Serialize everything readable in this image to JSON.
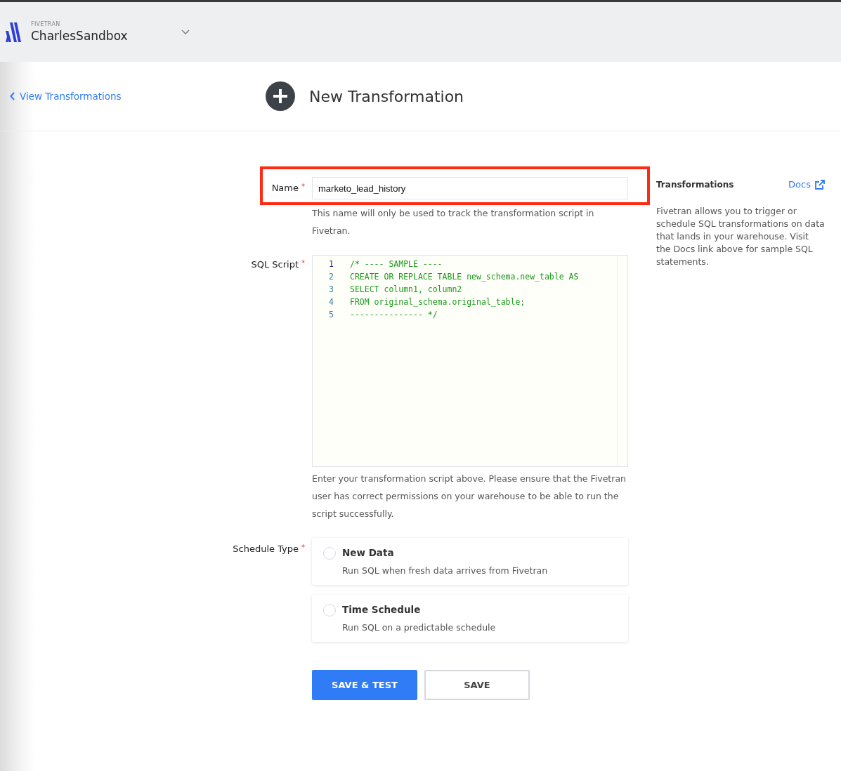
{
  "account": {
    "brand": "FIVETRAN",
    "name": "CharlesSandbox"
  },
  "header": {
    "back_link": "View Transformations",
    "title": "New Transformation"
  },
  "form": {
    "name_field": {
      "label": "Name",
      "required_mark": "*",
      "value": "marketo_lead_history",
      "highlighted": true,
      "help": "This name will only be used to track the transformation script in Fivetran."
    },
    "sql_field": {
      "label": "SQL Script",
      "required_mark": "*",
      "lines": [
        {
          "number": "1",
          "code": "/* ---- SAMPLE ----"
        },
        {
          "number": "2",
          "code": "CREATE OR REPLACE TABLE new_schema.new_table AS"
        },
        {
          "number": "3",
          "code": "SELECT column1, column2"
        },
        {
          "number": "4",
          "code": "FROM original_schema.original_table;"
        },
        {
          "number": "5",
          "code": "--------------- */"
        }
      ],
      "help": "Enter your transformation script above. Please ensure that the Fivetran user has correct permissions on your warehouse to be able to run the script successfully."
    },
    "schedule": {
      "label": "Schedule Type",
      "required_mark": "*",
      "options": [
        {
          "title": "New Data",
          "description": "Run SQL when fresh data arrives from Fivetran",
          "selected": false
        },
        {
          "title": "Time Schedule",
          "description": "Run SQL on a predictable schedule",
          "selected": false
        }
      ]
    },
    "buttons": [
      {
        "label": "SAVE & TEST",
        "kind": "primary"
      },
      {
        "label": "SAVE",
        "kind": "secondary"
      }
    ]
  },
  "sidebar": {
    "title": "Transformations",
    "docs_link": "Docs",
    "text": "Fivetran allows you to trigger or schedule SQL transformations on data that lands in your warehouse. Visit the Docs link above for sample SQL statements."
  }
}
